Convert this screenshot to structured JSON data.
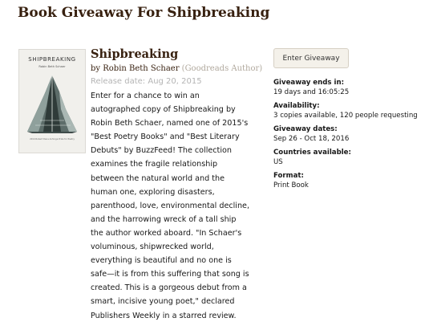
{
  "page": {
    "title": "Book Giveaway For Shipbreaking"
  },
  "book": {
    "cover": {
      "title_text": "SHIPBREAKING",
      "author_text": "Robin Beth Schaer",
      "footer_text": "2014 Robert Dana Anhinga Prize for Poetry"
    },
    "title": "Shipbreaking",
    "by_label": "by",
    "author": "Robin Beth Schaer",
    "author_role": "(Goodreads Author)",
    "release_date": "Release date: Aug 20, 2015",
    "description_lines": [
      "Enter for a chance to win an",
      "autographed copy of Shipbreaking by",
      "Robin Beth Schaer, named one of 2015's",
      "\"Best Poetry Books\" and \"Best Literary",
      "Debuts\" by BuzzFeed! The collection",
      "examines the fragile relationship",
      "between the natural world and the",
      "human one, exploring disasters,",
      "parenthood, love, environmental decline,",
      "and the harrowing wreck of a tall ship",
      "the author worked aboard. \"In Schaer's",
      "voluminous, shipwrecked world,",
      "everything is beautiful and no one is",
      "safe—it is from this suffering that song is",
      "created. This is a gorgeous debut from a",
      "smart, incisive young poet,\" declared",
      "Publishers Weekly in a starred review."
    ]
  },
  "giveaway": {
    "enter_button_label": "Enter Giveaway",
    "ends_label": "Giveaway ends in:",
    "ends_value": "19 days and 16:05:25",
    "availability_label": "Availability:",
    "availability_value": "3 copies available, 120 people requesting",
    "dates_label": "Giveaway dates:",
    "dates_value": "Sep 26 - Oct 18, 2016",
    "countries_label": "Countries available:",
    "countries_value": "US",
    "format_label": "Format:",
    "format_value": "Print Book"
  },
  "colors": {
    "brand_brown": "#382110",
    "button_bg": "#f4f1ea",
    "muted_text": "#b4b4b4"
  }
}
